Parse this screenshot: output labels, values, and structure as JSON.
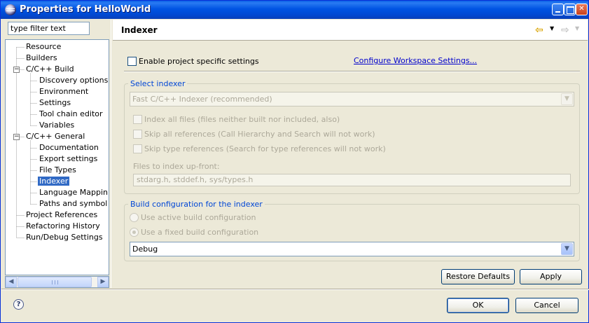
{
  "window": {
    "title": "Properties for HelloWorld"
  },
  "filter": {
    "value": "type filter text"
  },
  "tree": {
    "items": [
      {
        "label": "Resource",
        "level": 0,
        "expander": ""
      },
      {
        "label": "Builders",
        "level": 0,
        "expander": ""
      },
      {
        "label": "C/C++ Build",
        "level": 0,
        "expander": "−"
      },
      {
        "label": "Discovery options",
        "level": 1,
        "expander": ""
      },
      {
        "label": "Environment",
        "level": 1,
        "expander": ""
      },
      {
        "label": "Settings",
        "level": 1,
        "expander": ""
      },
      {
        "label": "Tool chain editor",
        "level": 1,
        "expander": ""
      },
      {
        "label": "Variables",
        "level": 1,
        "expander": ""
      },
      {
        "label": "C/C++ General",
        "level": 0,
        "expander": "−"
      },
      {
        "label": "Documentation",
        "level": 1,
        "expander": ""
      },
      {
        "label": "Export settings",
        "level": 1,
        "expander": ""
      },
      {
        "label": "File Types",
        "level": 1,
        "expander": ""
      },
      {
        "label": "Indexer",
        "level": 1,
        "expander": "",
        "selected": true
      },
      {
        "label": "Language Mappin",
        "level": 1,
        "expander": ""
      },
      {
        "label": "Paths and symbol",
        "level": 1,
        "expander": ""
      },
      {
        "label": "Project References",
        "level": 0,
        "expander": ""
      },
      {
        "label": "Refactoring History",
        "level": 0,
        "expander": ""
      },
      {
        "label": "Run/Debug Settings",
        "level": 0,
        "expander": ""
      }
    ]
  },
  "page": {
    "title": "Indexer",
    "enable_project_specific": "Enable project specific settings",
    "configure_workspace_link": "Configure Workspace Settings...",
    "select_indexer": {
      "group_title": "Select indexer",
      "indexer_combo_value": "Fast C/C++ Indexer (recommended)",
      "index_all_files": "Index all files (files neither built nor included, also)",
      "skip_all_references": "Skip all references (Call Hierarchy and Search will not work)",
      "skip_type_references": "Skip type references (Search for type references will not work)",
      "files_up_front_label": "Files to index up-front:",
      "files_up_front_value": "stdarg.h, stddef.h, sys/types.h"
    },
    "build_config": {
      "group_title": "Build configuration for the indexer",
      "use_active": "Use active build configuration",
      "use_fixed": "Use a fixed build configuration",
      "config_combo_value": "Debug"
    },
    "restore_defaults": "Restore Defaults",
    "apply": "Apply"
  },
  "dialog": {
    "ok": "OK",
    "cancel": "Cancel",
    "help_symbol": "?"
  },
  "icons": {
    "back": "back-arrow-icon",
    "forward": "forward-arrow-icon",
    "help": "help-icon",
    "app": "eclipse-icon"
  },
  "colors": {
    "titlebar": "#0054e3",
    "selection": "#316ac5",
    "group_title": "#0046d5",
    "link": "#0000cc"
  }
}
